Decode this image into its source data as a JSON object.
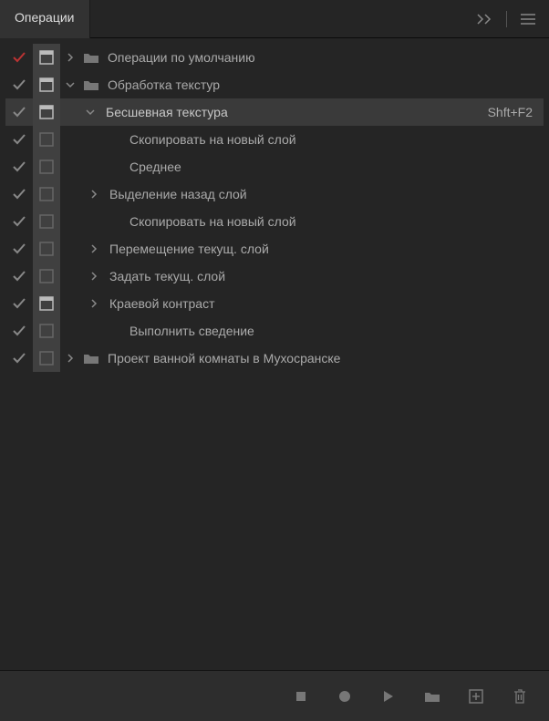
{
  "header": {
    "tab_label": "Операции",
    "collapse_label": ">>"
  },
  "rows": [
    {
      "check": "red",
      "box": "header",
      "chevron": "right",
      "folder": true,
      "indent": 0,
      "label": "Операции по умолчанию",
      "selected": false,
      "shortcut": ""
    },
    {
      "check": "gray",
      "box": "header",
      "chevron": "down",
      "folder": true,
      "indent": 0,
      "label": "Обработка текстур",
      "selected": false,
      "shortcut": ""
    },
    {
      "check": "gray",
      "box": "header",
      "chevron": "down",
      "folder": false,
      "indent": 22,
      "label": "Бесшевная текстура",
      "selected": true,
      "shortcut": "Shft+F2"
    },
    {
      "check": "gray",
      "box": "empty",
      "chevron": "",
      "folder": false,
      "indent": 48,
      "label": "Скопировать на новый слой",
      "selected": false,
      "shortcut": ""
    },
    {
      "check": "gray",
      "box": "empty",
      "chevron": "",
      "folder": false,
      "indent": 48,
      "label": "Среднее",
      "selected": false,
      "shortcut": ""
    },
    {
      "check": "gray",
      "box": "empty",
      "chevron": "right",
      "folder": false,
      "indent": 26,
      "label": "Выделение назад слой",
      "selected": false,
      "shortcut": ""
    },
    {
      "check": "gray",
      "box": "empty",
      "chevron": "",
      "folder": false,
      "indent": 48,
      "label": "Скопировать на новый слой",
      "selected": false,
      "shortcut": ""
    },
    {
      "check": "gray",
      "box": "empty",
      "chevron": "right",
      "folder": false,
      "indent": 26,
      "label": "Перемещение текущ. слой",
      "selected": false,
      "shortcut": ""
    },
    {
      "check": "gray",
      "box": "empty",
      "chevron": "right",
      "folder": false,
      "indent": 26,
      "label": "Задать текущ. слой",
      "selected": false,
      "shortcut": ""
    },
    {
      "check": "gray",
      "box": "header",
      "chevron": "right",
      "folder": false,
      "indent": 26,
      "label": "Краевой контраст",
      "selected": false,
      "shortcut": ""
    },
    {
      "check": "gray",
      "box": "empty",
      "chevron": "",
      "folder": false,
      "indent": 48,
      "label": "Выполнить сведение",
      "selected": false,
      "shortcut": ""
    },
    {
      "check": "gray",
      "box": "empty",
      "chevron": "right",
      "folder": true,
      "indent": 0,
      "label": "Проект ванной комнаты в Мухосранске",
      "selected": false,
      "shortcut": ""
    }
  ],
  "bottombar": {
    "stop": "stop",
    "record": "record",
    "play": "play",
    "folder": "folder",
    "new": "new",
    "trash": "trash"
  }
}
